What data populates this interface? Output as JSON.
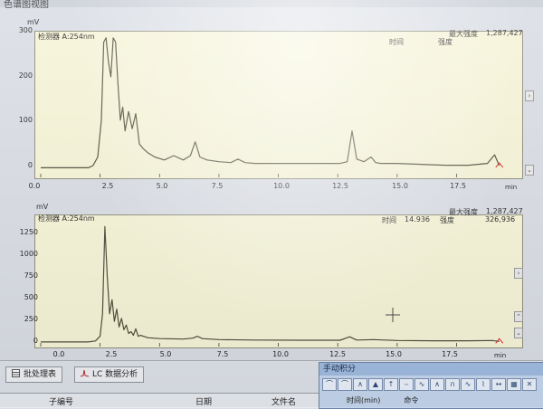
{
  "window": {
    "title": "色谱图视图"
  },
  "top_panel": {
    "ylabel": "mV",
    "detector": "检测器 A:254nm",
    "max_intensity_label": "最大强度",
    "max_intensity_value": "1,287,427",
    "time_label": "时间",
    "intensity_label": "强度",
    "time_value": "",
    "intensity_value": "",
    "xunit": "min",
    "yticks": [
      "300",
      "200",
      "100",
      "0"
    ],
    "xticks": [
      "0.0",
      "2.5",
      "5.0",
      "7.5",
      "10.0",
      "12.5",
      "15.0",
      "17.5"
    ]
  },
  "bottom_panel": {
    "ylabel": "mV",
    "detector": "检测器 A:254nm",
    "max_intensity_label": "最大强度",
    "max_intensity_value": "1,287,427",
    "time_label": "时间",
    "time_value": "14.936",
    "intensity_label": "强度",
    "intensity_value": "326,936",
    "xunit": "min",
    "yticks": [
      "1250",
      "1000",
      "750",
      "500",
      "250",
      "0"
    ],
    "xticks": [
      "0.0",
      "2.5",
      "5.0",
      "7.5",
      "10.0",
      "12.5",
      "15.0",
      "17.5"
    ]
  },
  "tabs": [
    {
      "label": "批处理表"
    },
    {
      "label": "LC 数据分析"
    }
  ],
  "table": {
    "columns": [
      "子编号",
      "日期",
      "文件名"
    ]
  },
  "manual_integration": {
    "title": "手动积分",
    "columns": [
      "时间(min)",
      "命令"
    ]
  },
  "chart_data": [
    {
      "type": "line",
      "title": "",
      "xlabel": "min",
      "ylabel": "mV",
      "xlim": [
        0,
        19.5
      ],
      "ylim": [
        -20,
        310
      ],
      "series": [
        {
          "x": [
            0.0,
            2.0,
            2.2,
            2.4,
            2.55,
            2.65,
            2.75,
            2.85,
            2.95,
            3.05,
            3.15,
            3.25,
            3.35,
            3.45,
            3.55,
            3.7,
            3.85,
            4.0,
            4.15,
            4.3,
            4.5,
            4.8,
            5.2,
            5.6,
            6.0,
            6.3,
            6.5,
            6.7,
            7.0,
            7.5,
            8.0,
            8.3,
            8.6,
            9.0,
            10.0,
            11.0,
            12.0,
            12.6,
            12.9,
            13.1,
            13.3,
            13.6,
            13.9,
            14.1,
            14.3,
            15.0,
            16.0,
            17.0,
            18.0,
            18.8,
            19.1,
            19.3
          ],
          "y": [
            0,
            0,
            5,
            25,
            110,
            290,
            300,
            245,
            210,
            300,
            290,
            195,
            110,
            140,
            85,
            130,
            90,
            125,
            55,
            45,
            35,
            25,
            18,
            28,
            18,
            28,
            60,
            25,
            18,
            14,
            12,
            20,
            12,
            10,
            10,
            10,
            10,
            10,
            14,
            85,
            20,
            14,
            25,
            12,
            10,
            10,
            8,
            6,
            6,
            10,
            30,
            5
          ]
        }
      ]
    },
    {
      "type": "line",
      "title": "",
      "xlabel": "min",
      "ylabel": "mV",
      "xlim": [
        0,
        19.5
      ],
      "ylim": [
        -40,
        1330
      ],
      "series": [
        {
          "x": [
            0.0,
            2.0,
            2.3,
            2.5,
            2.6,
            2.7,
            2.8,
            2.9,
            3.0,
            3.1,
            3.2,
            3.3,
            3.4,
            3.5,
            3.6,
            3.7,
            3.8,
            3.9,
            4.0,
            4.1,
            4.2,
            4.5,
            5.0,
            6.0,
            6.4,
            6.6,
            6.8,
            7.5,
            9.0,
            11.0,
            12.6,
            13.0,
            13.3,
            14.0,
            15.0,
            16.5,
            18.0,
            19.0,
            19.3
          ],
          "y": [
            0,
            0,
            10,
            60,
            300,
            1230,
            700,
            300,
            450,
            220,
            350,
            160,
            250,
            130,
            180,
            90,
            110,
            70,
            140,
            60,
            70,
            45,
            35,
            30,
            40,
            60,
            35,
            25,
            20,
            18,
            18,
            55,
            20,
            25,
            15,
            12,
            12,
            15,
            5
          ]
        }
      ]
    }
  ],
  "colors": {
    "plot_bg": "#f6f4d6",
    "trace": "#4a4a36",
    "axis": "#3c3c3c",
    "panel_bg": "#e6e9ee",
    "accent": "#6b83a8"
  }
}
